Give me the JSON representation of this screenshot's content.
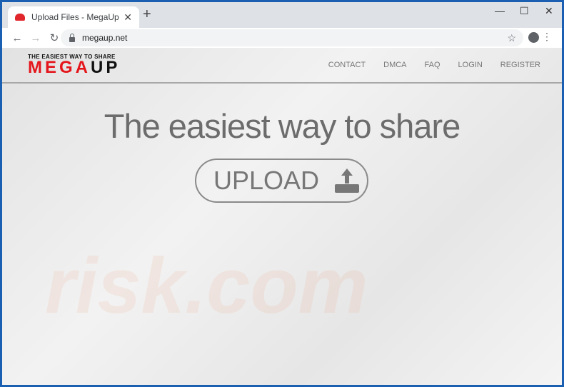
{
  "browser": {
    "tab_title": "Upload Files - MegaUp",
    "url": "megaup.net"
  },
  "site": {
    "logo": {
      "tagline": "THE EASIEST WAY TO SHARE",
      "mega": "MEGA",
      "up": "UP"
    },
    "nav": [
      "CONTACT",
      "DMCA",
      "FAQ",
      "LOGIN",
      "REGISTER"
    ],
    "headline": "The easiest way to share",
    "upload_label": "UPLOAD",
    "watermark": "risk.com"
  },
  "colors": {
    "brand_red": "#e4161c",
    "window_border": "#1b5fb3"
  }
}
